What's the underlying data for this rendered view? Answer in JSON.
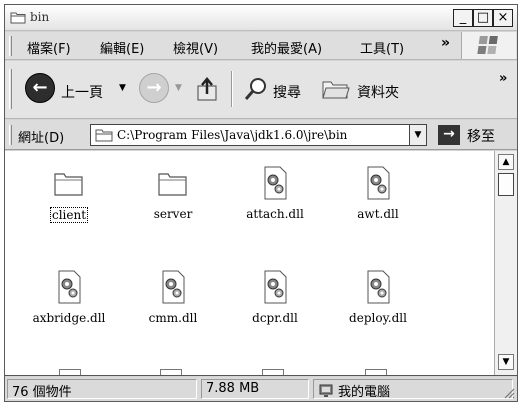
{
  "window": {
    "title": "bin"
  },
  "title_buttons": {
    "minimize": "_",
    "maximize": "□",
    "close": "×"
  },
  "menu": {
    "items": [
      "檔案(F)",
      "編輯(E)",
      "檢視(V)",
      "我的最愛(A)",
      "工具(T)"
    ],
    "overflow": "»"
  },
  "toolbar": {
    "back_label": "上一頁",
    "forward_label": "",
    "search_label": "搜尋",
    "folders_label": "資料夾",
    "overflow": "»"
  },
  "address": {
    "label": "網址(D)",
    "value": "C:\\Program Files\\Java\\jdk1.6.0\\jre\\bin",
    "go_label": "移至"
  },
  "files": [
    {
      "name": "client",
      "icon": "folder-icon",
      "selected": true
    },
    {
      "name": "server",
      "icon": "folder-icon"
    },
    {
      "name": "attach.dll",
      "icon": "dll-gear-icon"
    },
    {
      "name": "awt.dll",
      "icon": "dll-gear-icon"
    },
    {
      "name": "axbridge.dll",
      "icon": "dll-gear-icon"
    },
    {
      "name": "cmm.dll",
      "icon": "dll-gear-icon"
    },
    {
      "name": "dcpr.dll",
      "icon": "dll-gear-icon"
    },
    {
      "name": "deploy.dll",
      "icon": "dll-gear-icon"
    }
  ],
  "status": {
    "object_count": "76 個物件",
    "size": "7.88 MB",
    "location": "我的電腦"
  }
}
